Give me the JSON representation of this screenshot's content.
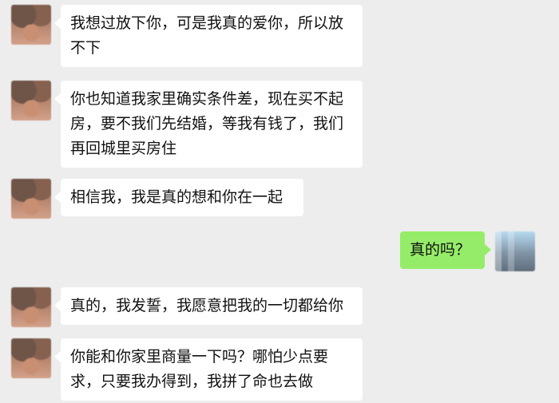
{
  "messages": [
    {
      "side": "left",
      "text": "我想过放下你，可是我真的爱你，所以放不下"
    },
    {
      "side": "left",
      "text": "你也知道我家里确实条件差，现在买不起房，要不我们先结婚，等我有钱了，我们再回城里买房住"
    },
    {
      "side": "left",
      "text": "相信我，我是真的想和你在一起"
    },
    {
      "side": "right",
      "text": "真的吗？"
    },
    {
      "side": "left",
      "text": "真的，我发誓，我愿意把我的一切都给你"
    },
    {
      "side": "left",
      "text": "你能和你家里商量一下吗？哪怕少点要求，只要我办得到，我拼了命也去做"
    }
  ]
}
